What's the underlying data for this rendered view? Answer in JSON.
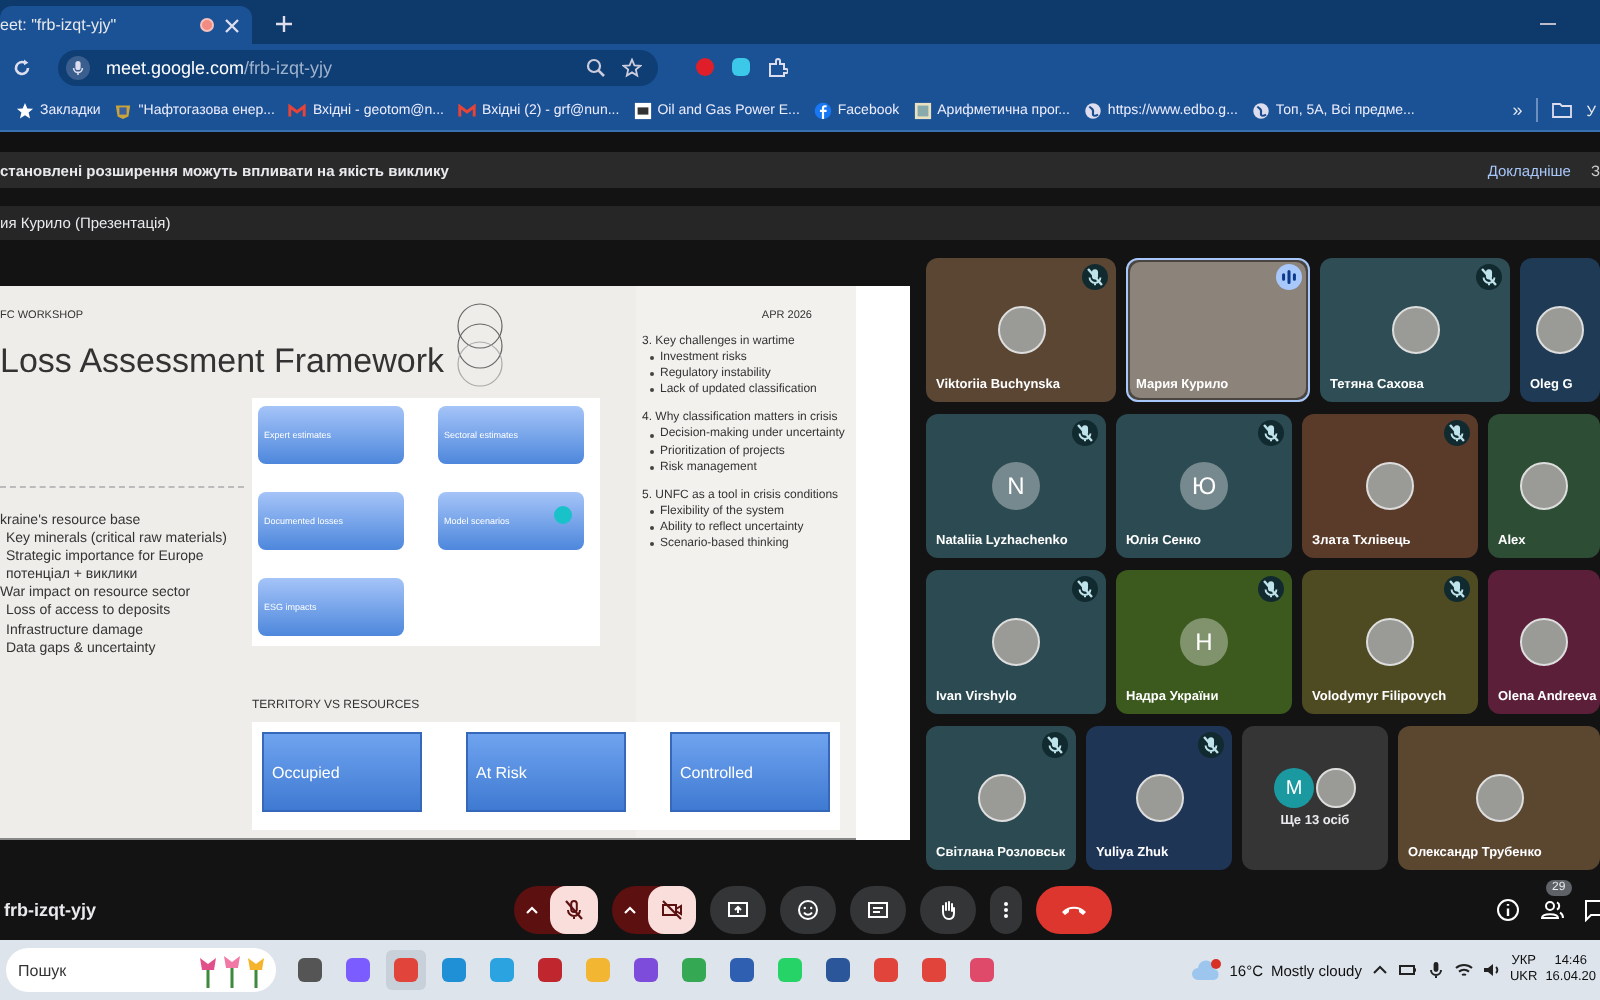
{
  "browser": {
    "tab": {
      "title": "eet: \"frb-izqt-yjy\"",
      "recording": true
    },
    "url": {
      "domain": "meet.google.com",
      "path": "/frb-izqt-yjy"
    },
    "bookmarks": [
      {
        "label": "Закладки",
        "kind": "star"
      },
      {
        "label": "\"Нафтогазова енер...",
        "kind": "emblem"
      },
      {
        "label": "Вхідні - geotom@n...",
        "kind": "mail"
      },
      {
        "label": "Вхідні (2) - grf@nun...",
        "kind": "mail"
      },
      {
        "label": "Oil and Gas Power E...",
        "kind": "logo"
      },
      {
        "label": "Facebook",
        "kind": "facebook"
      },
      {
        "label": "Арифметична прог...",
        "kind": "image"
      },
      {
        "label": "https://www.edbo.g...",
        "kind": "globe"
      },
      {
        "label": "Топ, 5А, Всі предме...",
        "kind": "globe"
      }
    ],
    "more": "»",
    "folder": "У"
  },
  "notice": {
    "text": "становлені розширення можуть впливати на якість виклику",
    "link": "Докладніше",
    "extra": "З"
  },
  "presenter": "ия Курило (Презентація)",
  "slide": {
    "label": "FC WORKSHOP",
    "date": "APR 2026",
    "title": "Loss Assessment Framework",
    "left": [
      {
        "kind": "heading",
        "text": "kraine's resource base"
      },
      {
        "kind": "item",
        "text": "Key minerals (critical raw materials)"
      },
      {
        "kind": "item",
        "text": "Strategic importance for Europe"
      },
      {
        "kind": "item",
        "text": "потенціал + виклики"
      },
      {
        "kind": "heading",
        "text": "War impact on resource sector"
      },
      {
        "kind": "item",
        "text": "Loss of access to deposits"
      },
      {
        "kind": "item",
        "text": "Infrastructure damage"
      },
      {
        "kind": "item",
        "text": "Data gaps & uncertainty"
      }
    ],
    "diagram": [
      "Expert estimates",
      "Sectoral estimates",
      "Documented losses",
      "Model scenarios",
      "ESG impacts"
    ],
    "cursor": true,
    "territory_title": "TERRITORY VS RESOURCES",
    "territory": [
      "Occupied",
      "At Risk",
      "Controlled"
    ],
    "sections": [
      {
        "heading": "3. Key challenges in wartime",
        "bullets": [
          "Investment risks",
          "Regulatory instability",
          "Lack of updated classification"
        ]
      },
      {
        "heading": "4. Why classification matters in crisis",
        "bullets": [
          "Decision-making under uncertainty",
          "Prioritization of projects",
          "Risk management"
        ]
      },
      {
        "heading": "5. UNFC as a tool in crisis conditions",
        "bullets": [
          "Flexibility of the system",
          "Ability to reflect uncertainty",
          "Scenario-based thinking"
        ]
      }
    ]
  },
  "participants": [
    {
      "tiles": [
        {
          "name": "Viktoriia Buchynska",
          "kind": "photo",
          "muted": true,
          "speaking": false,
          "color": "#5a4633"
        },
        {
          "name": "Мария Курило",
          "kind": "video",
          "muted": false,
          "speaking": true,
          "color": "#4a4540"
        },
        {
          "name": "Тетяна Сахова",
          "kind": "photo",
          "muted": true,
          "speaking": false,
          "color": "#2f4d55"
        },
        {
          "name": "Oleg G",
          "kind": "photo",
          "muted": false,
          "speaking": false,
          "color": "#1f3a55"
        }
      ]
    },
    {
      "tiles": [
        {
          "name": "Nataliia Lyzhachenko",
          "kind": "letter",
          "letter": "N",
          "muted": true,
          "speaking": false,
          "color": "#2c4a52"
        },
        {
          "name": "Юлія Сенко",
          "kind": "letter",
          "letter": "Ю",
          "muted": true,
          "speaking": false,
          "color": "#2c4a52"
        },
        {
          "name": "Злата Тхлівець",
          "kind": "photo",
          "muted": true,
          "speaking": false,
          "color": "#5a3b2a"
        },
        {
          "name": "Alex",
          "kind": "photo",
          "muted": false,
          "speaking": false,
          "color": "#2d4d35"
        }
      ]
    },
    {
      "tiles": [
        {
          "name": "Ivan Virshylo",
          "kind": "photo",
          "muted": true,
          "speaking": false,
          "color": "#2c4a52"
        },
        {
          "name": "Надра України",
          "kind": "letter",
          "letter": "Н",
          "muted": true,
          "speaking": false,
          "color": "#3d5a1e"
        },
        {
          "name": "Volodymyr Filipovych",
          "kind": "photo",
          "muted": true,
          "speaking": false,
          "color": "#4e4a22"
        },
        {
          "name": "Olena Andreeva",
          "kind": "photo",
          "muted": false,
          "speaking": false,
          "color": "#5c1f3a"
        }
      ]
    },
    {
      "tiles": [
        {
          "name": "Світлана Розловськ",
          "kind": "photo",
          "muted": true,
          "speaking": false,
          "color": "#2c4a52"
        },
        {
          "name": "Yuliya Zhuk",
          "kind": "photo",
          "muted": true,
          "speaking": false,
          "color": "#1f3556"
        },
        {
          "label": "Ще 13 осіб",
          "kind": "more",
          "letter": "M",
          "muted": false,
          "speaking": false,
          "color": "#353535"
        },
        {
          "name": "Олександр Трубенко",
          "kind": "photo",
          "muted": false,
          "speaking": false,
          "color": "#5b4630"
        }
      ]
    }
  ],
  "call": {
    "code": "frb-izqt-yjy",
    "mic_on": false,
    "camera_on": false,
    "people_count": "29"
  },
  "taskbar": {
    "search_placeholder": "Пошук",
    "temperature": "16°C",
    "weather": "Mostly cloudy",
    "language": [
      "УКР",
      "UKR"
    ],
    "time": "14:46",
    "date": "16.04.20"
  }
}
